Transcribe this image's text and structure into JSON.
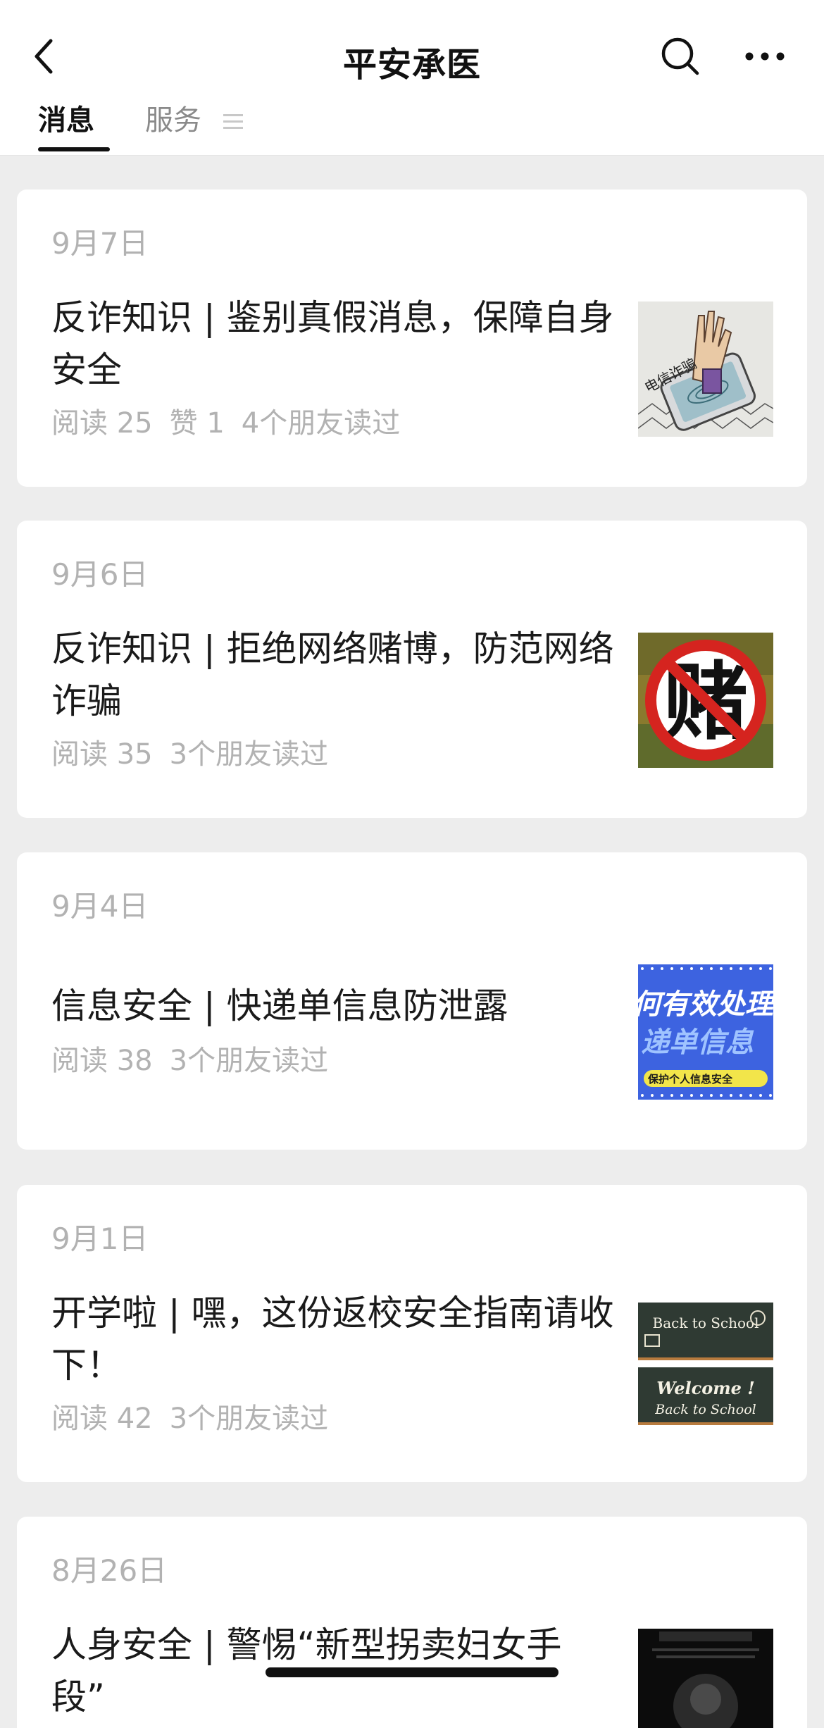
{
  "header": {
    "title": "平安承医",
    "back_icon": "chevron-left-icon",
    "search_icon": "search-icon",
    "more_icon": "more-dots-icon"
  },
  "tabs": [
    {
      "label": "消息",
      "active": true
    },
    {
      "label": "服务",
      "active": false,
      "icon": "menu-lines-icon"
    }
  ],
  "articles": [
    {
      "date": "9月7日",
      "title": "反诈知识 | 鉴别真假消息，保障自身安全",
      "reads": "阅读 25",
      "likes": "赞 1",
      "friends": "4个朋友读过",
      "thumb_text": "电信诈骗",
      "thumb_icon": "phone-hand-icon"
    },
    {
      "date": "9月6日",
      "title": "反诈知识 | 拒绝网络赌博，防范网络诈骗",
      "reads": "阅读 35",
      "friends": "3个朋友读过",
      "thumb_text": "赌",
      "thumb_icon": "no-gambling-icon"
    },
    {
      "date": "9月4日",
      "title": "信息安全 | 快递单信息防泄露",
      "reads": "阅读 38",
      "friends": "3个朋友读过",
      "thumb_text": "何有效处理",
      "thumb_text2": "递单信息",
      "thumb_text3": "保护个人信息安全",
      "thumb_icon": "info-poster-icon"
    },
    {
      "date": "9月1日",
      "title": "开学啦 | 嘿，这份返校安全指南请收下！",
      "reads": "阅读 42",
      "friends": "3个朋友读过",
      "thumb_text": "Back to School",
      "thumb_text2": "Welcome !",
      "thumb_text3": "Back to School",
      "thumb_icon": "chalkboard-icon"
    },
    {
      "date": "8月26日",
      "title": "人身安全 | 警惕“新型拐卖妇女手段”",
      "thumb_icon": "dark-poster-icon"
    }
  ],
  "colors": {
    "background": "#ededed",
    "card": "#ffffff",
    "meta_text": "#b2b2b2",
    "title_text": "#1a1a1a"
  }
}
